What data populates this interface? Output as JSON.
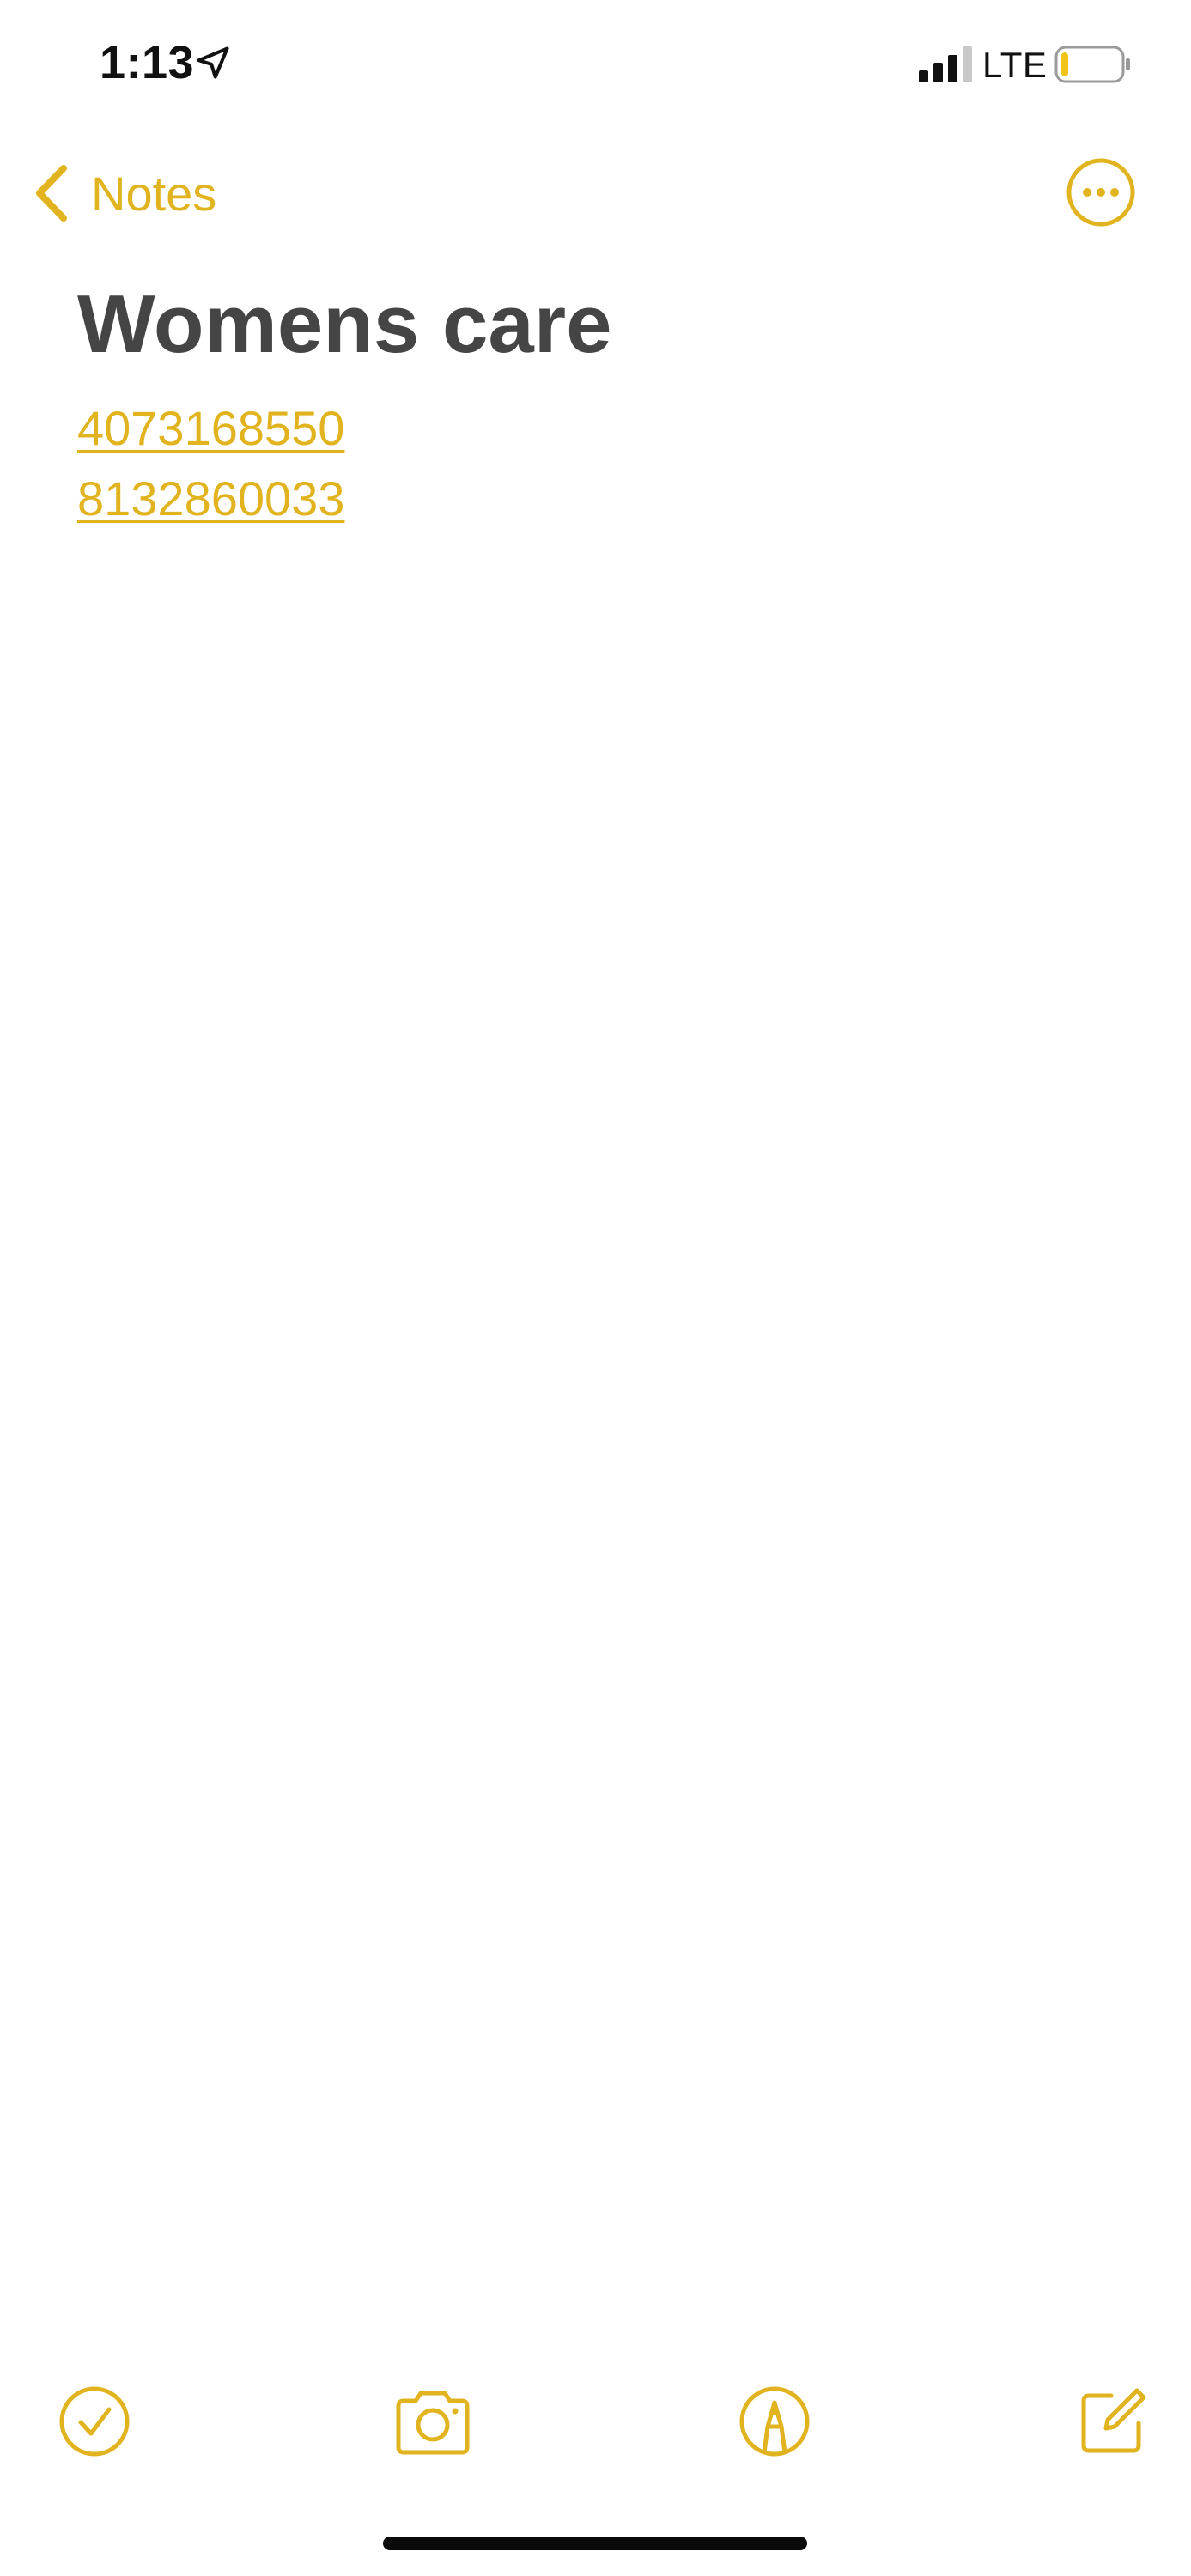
{
  "status_bar": {
    "time": "1:13",
    "network": "LTE",
    "location_icon": "location-arrow-icon",
    "signal_icon": "cellular-signal-icon",
    "battery_icon": "battery-low-icon",
    "battery_fill_fraction": 0.12
  },
  "nav": {
    "back_label": "Notes",
    "back_icon": "chevron-left-icon",
    "more_icon": "ellipsis-circle-icon"
  },
  "note": {
    "title": "Womens care",
    "phones": [
      "4073168550",
      "8132860033"
    ]
  },
  "toolbar": {
    "checklist_icon": "checklist-icon",
    "camera_icon": "camera-icon",
    "markup_icon": "markup-pen-icon",
    "compose_icon": "compose-icon"
  },
  "colors": {
    "accent": "#E1B31E",
    "title_text": "#454545",
    "background": "#FFFFFF"
  }
}
